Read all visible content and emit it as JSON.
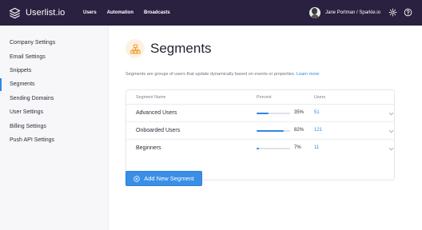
{
  "app": {
    "name": "Userlist.io"
  },
  "nav": {
    "items": [
      "Users",
      "Automation",
      "Broadcasts"
    ]
  },
  "user": {
    "name": "Jane Portman / Sparkle.io"
  },
  "sidebar": {
    "items": [
      {
        "label": "Company Settings",
        "active": false
      },
      {
        "label": "Email Settings",
        "active": false
      },
      {
        "label": "Snippets",
        "active": false
      },
      {
        "label": "Segments",
        "active": true
      },
      {
        "label": "Sending Domains",
        "active": false
      },
      {
        "label": "User Settings",
        "active": false
      },
      {
        "label": "Billing Settings",
        "active": false
      },
      {
        "label": "Push API Settings",
        "active": false
      }
    ]
  },
  "page": {
    "title": "Segments",
    "description": "Segments are groups of users that update dynamically based on events or properties.",
    "learn_more": "Learn more"
  },
  "table": {
    "headers": {
      "name": "Segment Name",
      "percent": "Percent",
      "users": "Users"
    },
    "rows": [
      {
        "name": "Advanced Users",
        "percent_label": "35%",
        "percent": 35,
        "users": "51"
      },
      {
        "name": "Onboarded Users",
        "percent_label": "82%",
        "percent": 82,
        "users": "121"
      },
      {
        "name": "Beginners",
        "percent_label": "7%",
        "percent": 7,
        "users": "11"
      }
    ]
  },
  "actions": {
    "add_segment": "Add New Segment"
  },
  "colors": {
    "topbar": "#2a2040",
    "accent": "#2f86e8",
    "icon_bg": "#fdf1e1",
    "icon_fg": "#f0a031"
  },
  "icons": {
    "logo": "stack-layers-icon",
    "settings": "gear-icon",
    "help": "question-circle-icon",
    "segments": "segments-tree-icon",
    "chevron": "chevron-down-icon",
    "add": "plus-circle-icon"
  }
}
